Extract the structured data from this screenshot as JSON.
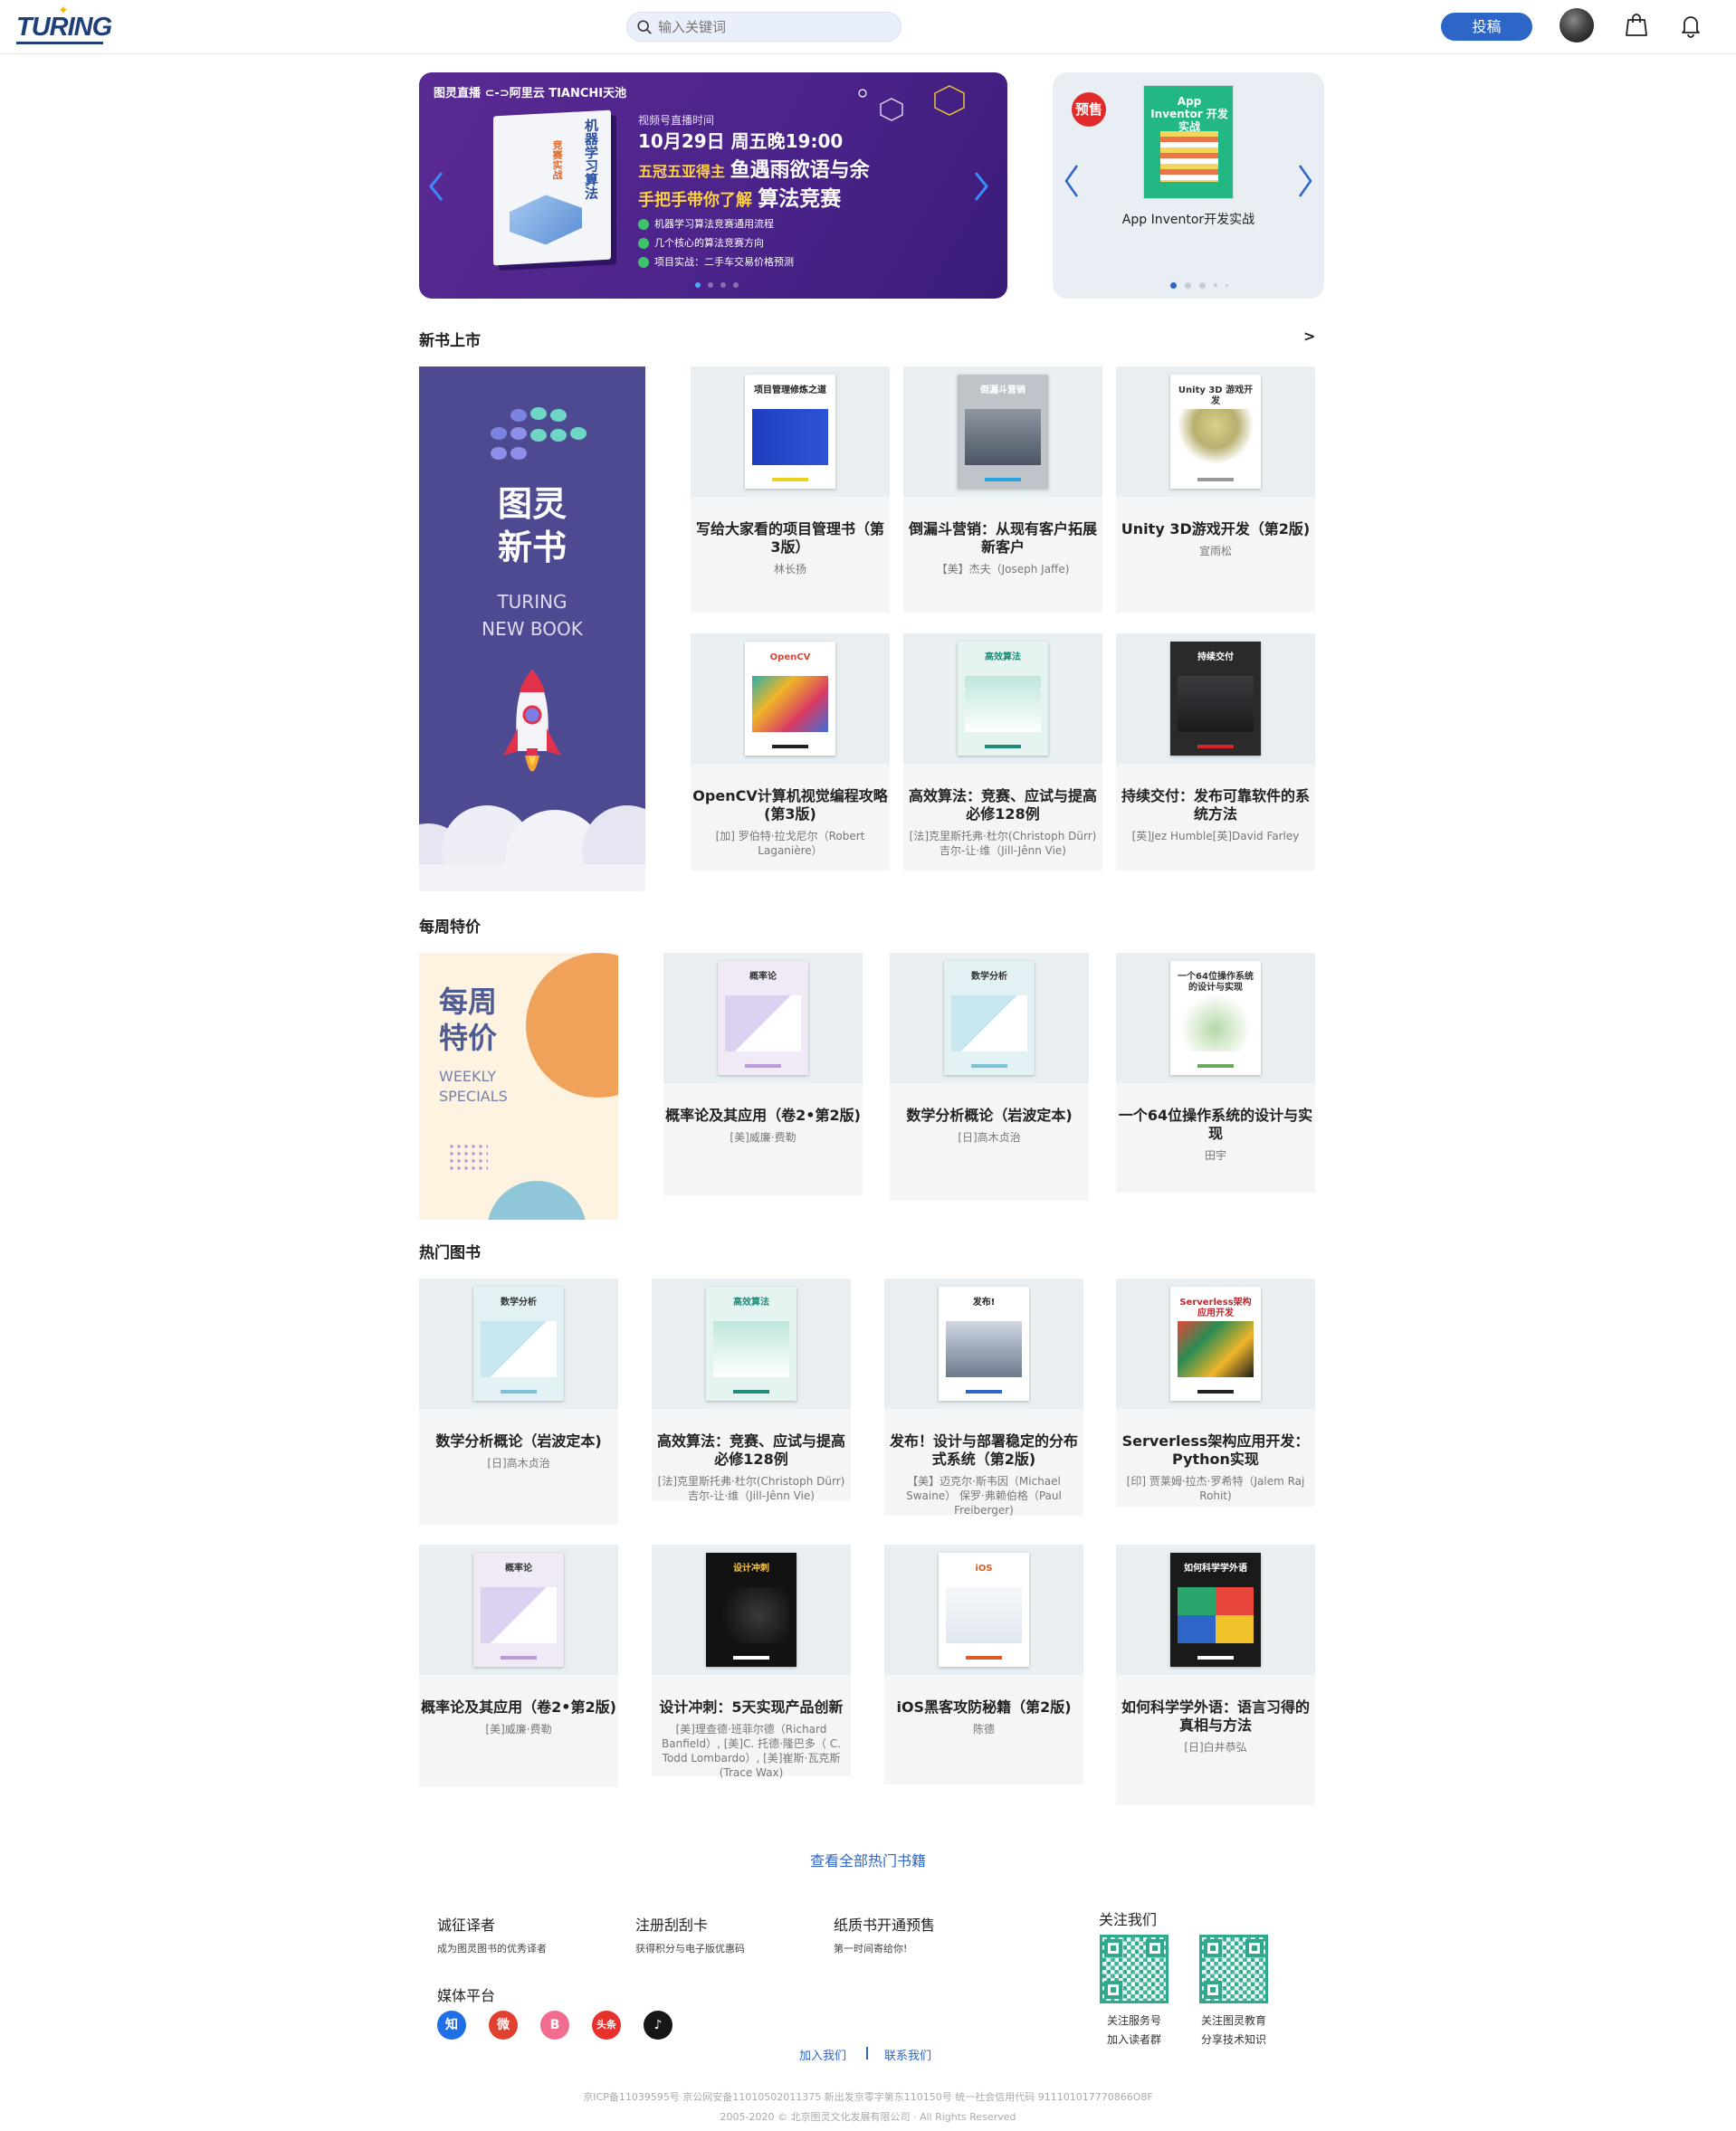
{
  "header": {
    "logo_text": "TURING",
    "search_placeholder": "输入关键词",
    "submit_label": "投稿"
  },
  "banner_main": {
    "top_brand": "图灵直播  ⊂-⊃阿里云  TIANCHI天池",
    "book_title": "机器学习算法",
    "book_subtitle": "竞赛实战",
    "time_label": "视频号直播时间",
    "time": "10月29日 周五晚19:00",
    "line1_prefix": "五冠五亚得主",
    "line1_names": "鱼遇雨欲语与余",
    "line2_prefix": "手把手带你了解",
    "line2_topic": "算法竞赛",
    "bullets": [
      "机器学习算法竞赛通用流程",
      "几个核心的算法竞赛方向",
      "项目实战：二手车交易价格预测"
    ],
    "slides": 4,
    "active_slide": 0
  },
  "banner_side": {
    "badge": "预售",
    "book_title": "App Inventor 开发实战",
    "caption": "App Inventor开发实战",
    "slides": 5,
    "active_slide": 0
  },
  "sections": {
    "new_books": "新书上市",
    "more": ">",
    "weekly": "每周特价",
    "hot": "热门图书"
  },
  "promo_new": {
    "title_line1": "图灵",
    "title_line2": "新书",
    "en_line1": "TURING",
    "en_line2": "NEW BOOK"
  },
  "promo_weekly": {
    "title_line1": "每周",
    "title_line2": "特价",
    "en_line1": "WEEKLY",
    "en_line2": "SPECIALS"
  },
  "new_books": [
    {
      "title": "写给大家看的项目管理书（第3版）",
      "author": "林长扬",
      "cover_text": "项目管理修炼之道"
    },
    {
      "title": "倒漏斗营销：从现有客户拓展新客户",
      "author": "【美】杰夫（Joseph Jaffe)",
      "cover_text": "倒漏斗营销"
    },
    {
      "title": "Unity 3D游戏开发（第2版)",
      "author": "宣雨松",
      "cover_text": "Unity 3D 游戏开发"
    },
    {
      "title": "OpenCV计算机视觉编程攻略(第3版)",
      "author": "[加] 罗伯特·拉戈尼尔（Robert Laganière）",
      "cover_text": "OpenCV"
    },
    {
      "title": "高效算法：竞赛、应试与提高必修128例",
      "author": "[法]克里斯托弗·杜尔(Christoph Dürr) 吉尔-让·维（Jill-Jênn Vie)",
      "cover_text": "高效算法"
    },
    {
      "title": "持续交付：发布可靠软件的系统方法",
      "author": "[英]Jez Humble[英]David Farley",
      "cover_text": "持续交付"
    }
  ],
  "weekly_books": [
    {
      "title": "概率论及其应用（卷2•第2版)",
      "author": "[美]威廉·费勒",
      "cover_text": "概率论"
    },
    {
      "title": "数学分析概论（岩波定本)",
      "author": "[日]高木贞治",
      "cover_text": "数学分析"
    },
    {
      "title": "一个64位操作系统的设计与实现",
      "author": "田宇",
      "cover_text": "一个64位操作系统的设计与实现"
    }
  ],
  "hot_books": [
    {
      "title": "数学分析概论（岩波定本)",
      "author": "[日]高木贞治",
      "cover_text": "数学分析"
    },
    {
      "title": "高效算法：竞赛、应试与提高必修128例",
      "author": "[法]克里斯托弗·杜尔(Christoph Dürr) 吉尔-让·维（Jill-Jênn Vie)",
      "cover_text": "高效算法"
    },
    {
      "title": "发布！设计与部署稳定的分布式系统（第2版)",
      "author": "【美】迈克尔·斯韦因（Michael Swaine） 保罗·弗赖伯格（Paul Freiberger)",
      "cover_text": "发布!"
    },
    {
      "title": "Serverless架构应用开发：Python实现",
      "author": "[印] 贾莱姆·拉杰·罗希特（Jalem Raj Rohit)",
      "cover_text": "Serverless架构应用开发"
    },
    {
      "title": "概率论及其应用（卷2•第2版)",
      "author": "[美]威廉·费勒",
      "cover_text": "概率论"
    },
    {
      "title": "设计冲刺：5天实现产品创新",
      "author": "[美]理查德·班菲尔德（Richard Banfield）, [美]C. 托德·隆巴多（ C. Todd Lombardo）, [美]崔斯·瓦克斯(Trace Wax)",
      "cover_text": "设计冲刺"
    },
    {
      "title": "iOS黑客攻防秘籍（第2版)",
      "author": "陈德",
      "cover_text": "iOS"
    },
    {
      "title": "如何科学学外语：语言习得的真相与方法",
      "author": "[日]白井恭弘",
      "cover_text": "如何科学学外语"
    }
  ],
  "view_all": "查看全部热门书籍",
  "footer": {
    "cols": [
      {
        "title": "诚征译者",
        "sub": "成为图灵图书的优秀译者"
      },
      {
        "title": "注册刮刮卡",
        "sub": "获得积分与电子版优惠码"
      },
      {
        "title": "纸质书开通预售",
        "sub": "第一时间寄给你!"
      }
    ],
    "media_title": "媒体平台",
    "media": [
      {
        "name": "zhihu",
        "glyph": "知",
        "color": "#1e6fe8"
      },
      {
        "name": "weibo",
        "glyph": "微",
        "color": "#e0402f"
      },
      {
        "name": "bilibili",
        "glyph": "B",
        "color": "#f06d8f"
      },
      {
        "name": "toutiao",
        "glyph": "头条",
        "color": "#e8302c"
      },
      {
        "name": "douyin",
        "glyph": "♪",
        "color": "#161616"
      }
    ],
    "follow_title": "关注我们",
    "qr": [
      {
        "line1": "关注服务号",
        "line2": "加入读者群"
      },
      {
        "line1": "关注图灵教育",
        "line2": "分享技术知识"
      }
    ],
    "join": "加入我们",
    "contact": "联系我们",
    "icp": "京ICP备11039595号  京公网安备11010502011375  新出发京零字第东110150号  统一社会信用代码 911101017770866O8F",
    "copyright": "2005-2020 © 北京图灵文化发展有限公司 · All Rights Reserved"
  }
}
